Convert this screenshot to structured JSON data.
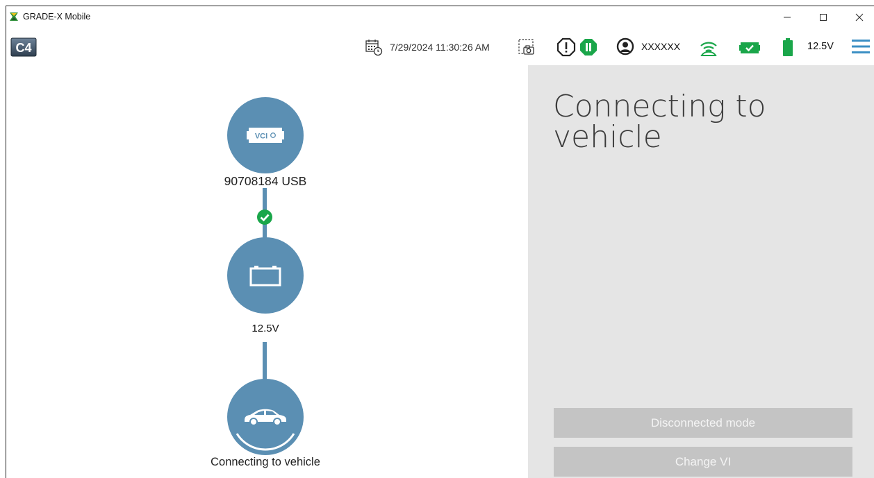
{
  "window": {
    "title": "GRADE-X Mobile",
    "controls": {
      "minimize_icon": "minimize-icon",
      "maximize_icon": "maximize-icon",
      "close_icon": "close-icon"
    }
  },
  "toolbar": {
    "logo_text": "C4",
    "datetime": "7/29/2024 11:30:26 AM",
    "username": "XXXXXX",
    "voltage": "12.5V",
    "icons": [
      "calendar-clock-icon",
      "screenshot-icon",
      "alert-icon",
      "pause-icon",
      "user-icon",
      "wireless-signal-icon",
      "vci-status-icon",
      "battery-icon",
      "hamburger-menu-icon"
    ]
  },
  "flow": {
    "vci_badge": "VCI",
    "vci_label": "90708184 USB",
    "battery_voltage": "12.5V",
    "vehicle_label": "Connecting to vehicle"
  },
  "panel": {
    "title": "Connecting to vehicle",
    "buttons": {
      "disconnected": "Disconnected mode",
      "change_vi": "Change VI"
    }
  },
  "colors": {
    "node_blue": "#5b8fb3",
    "status_green": "#1aa64a",
    "panel_gray": "#e5e5e5",
    "button_gray": "#c4c4c4",
    "menu_blue": "#3b8fc4"
  }
}
